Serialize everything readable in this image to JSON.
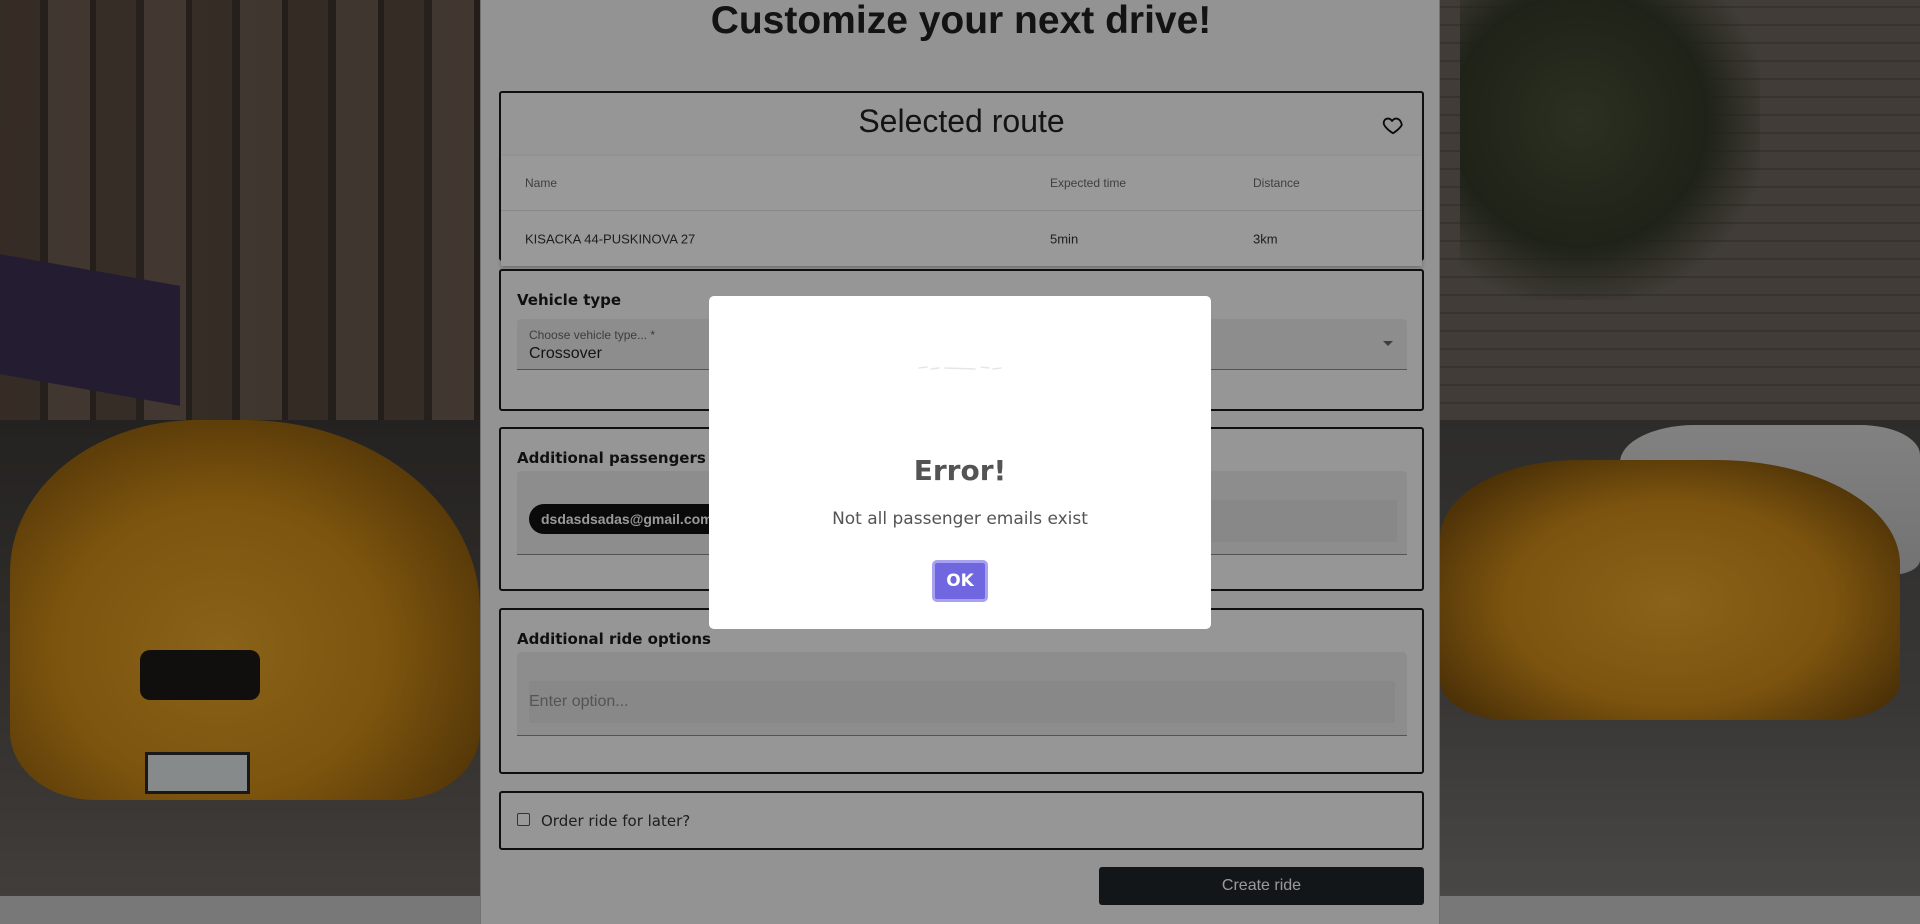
{
  "page": {
    "title": "Customize your next drive!"
  },
  "route": {
    "heading": "Selected route",
    "columns": [
      "Name",
      "Expected time",
      "Distance"
    ],
    "row": {
      "name": "KISACKA 44-PUSKINOVA 27",
      "expected_time": "5min",
      "distance": "3km"
    }
  },
  "vehicle": {
    "label": "Vehicle type",
    "select_label": "Choose vehicle type... *",
    "selected": "Crossover"
  },
  "passengers": {
    "label": "Additional passengers",
    "chips": [
      "dsdasdsadas@gmail.com"
    ]
  },
  "ride_options": {
    "label": "Additional ride options",
    "placeholder": "Enter option..."
  },
  "order_later": {
    "label": "Order ride for later?",
    "checked": false
  },
  "actions": {
    "create_ride": "Create ride"
  },
  "dialog": {
    "title": "Error!",
    "message": "Not all passenger emails exist",
    "ok_label": "OK",
    "confirm_color": "#7066e0"
  },
  "icons": {
    "favorite": "heart-outline-icon",
    "dialog": "error-icon"
  }
}
